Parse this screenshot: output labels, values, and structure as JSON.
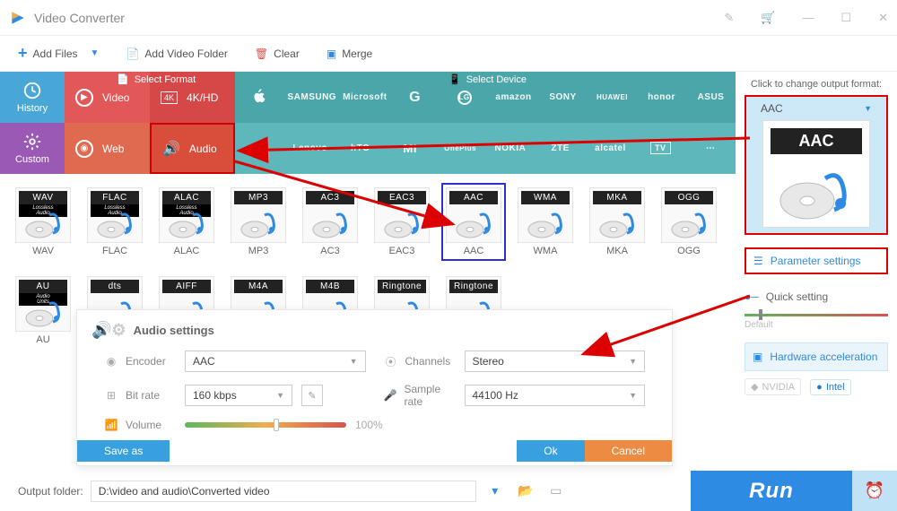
{
  "window": {
    "title": "Video Converter"
  },
  "toolbar": {
    "add_files": "Add Files",
    "add_video_folder": "Add Video Folder",
    "clear": "Clear",
    "merge": "Merge"
  },
  "left_tabs": {
    "history": "History",
    "custom": "Custom"
  },
  "format_header": "Select Format",
  "device_header": "Select Device",
  "format_cells": {
    "video": "Video",
    "fourk": "4K/HD",
    "web": "Web",
    "audio": "Audio"
  },
  "brands_top": [
    "",
    "SAMSUNG",
    "Microsoft",
    "G",
    "LG",
    "amazon",
    "SONY",
    "HUAWEI",
    "honor",
    "ASUS"
  ],
  "brands_bot": [
    "",
    "Lenovo",
    "hTC",
    "MI",
    "OnePlus",
    "NOKIA",
    "ZTE",
    "alcatel",
    "TV",
    ""
  ],
  "formats_row1": [
    {
      "code": "WAV",
      "name": "WAV",
      "sub": "Lossless Audio"
    },
    {
      "code": "FLAC",
      "name": "FLAC",
      "sub": "Lossless Audio"
    },
    {
      "code": "ALAC",
      "name": "ALAC",
      "sub": "Lossless Audio"
    },
    {
      "code": "MP3",
      "name": "MP3"
    },
    {
      "code": "AC3",
      "name": "AC3"
    },
    {
      "code": "EAC3",
      "name": "EAC3"
    },
    {
      "code": "AAC",
      "name": "AAC",
      "selected": true
    },
    {
      "code": "WMA",
      "name": "WMA"
    },
    {
      "code": "MKA",
      "name": "MKA"
    },
    {
      "code": "OGG",
      "name": "OGG"
    }
  ],
  "formats_row2": [
    {
      "code": "AU",
      "name": "AU",
      "sub": "Audio Units"
    },
    {
      "code": "dts",
      "name": ""
    },
    {
      "code": "AIFF",
      "name": ""
    },
    {
      "code": "M4A",
      "name": ""
    },
    {
      "code": "M4B",
      "name": ""
    },
    {
      "code": "Ringtone",
      "name": ""
    },
    {
      "code": "Ringtone",
      "name": ""
    }
  ],
  "audio_panel": {
    "title": "Audio settings",
    "encoder_label": "Encoder",
    "encoder_value": "AAC",
    "bitrate_label": "Bit rate",
    "bitrate_value": "160 kbps",
    "volume_label": "Volume",
    "volume_display": "100%",
    "channels_label": "Channels",
    "channels_value": "Stereo",
    "samplerate_label": "Sample rate",
    "samplerate_value": "44100 Hz",
    "save_as": "Save as",
    "ok": "Ok",
    "cancel": "Cancel"
  },
  "right": {
    "click_to_change": "Click to change output format:",
    "format_name": "AAC",
    "format_large": "AAC",
    "parameter_settings": "Parameter settings",
    "quick_setting": "Quick setting",
    "default_label": "Default",
    "hw_accel": "Hardware acceleration",
    "nvidia": "NVIDIA",
    "intel": "Intel"
  },
  "bottom": {
    "output_folder_label": "Output folder:",
    "output_folder_value": "D:\\video and audio\\Converted video",
    "run": "Run"
  }
}
